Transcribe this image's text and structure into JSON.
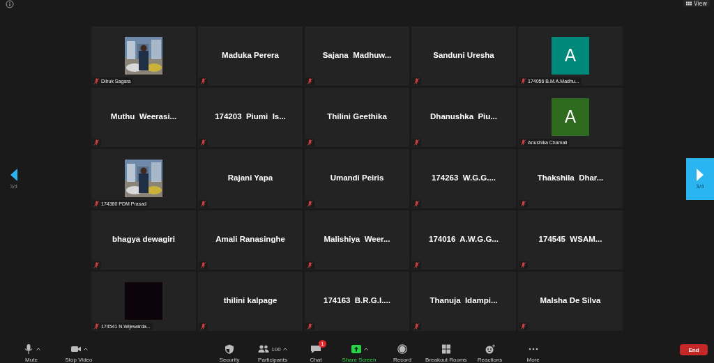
{
  "top_bar": {
    "view_button": "View"
  },
  "pager": {
    "left_page": "3/4",
    "right_page": "3/4",
    "right_highlighted": true
  },
  "tiles": [
    {
      "kind": "picture",
      "name": "Dilruk Sagara",
      "muted": true
    },
    {
      "kind": "name",
      "name": "Maduka Perera",
      "muted": true
    },
    {
      "kind": "name",
      "name": "Sajana  Madhuw...",
      "muted": true
    },
    {
      "kind": "name",
      "name": "Sanduni Uresha",
      "muted": true
    },
    {
      "kind": "avatar",
      "letter": "A",
      "color": "#00897b",
      "name": "174056 B.M.A.Madhu...",
      "muted": true
    },
    {
      "kind": "name",
      "name": "Muthu  Weerasi...",
      "muted": true
    },
    {
      "kind": "name",
      "name": "174203  Piumi  Is...",
      "muted": true
    },
    {
      "kind": "name",
      "name": "Thilini Geethika",
      "muted": true
    },
    {
      "kind": "name",
      "name": "Dhanushka  Piu...",
      "muted": true
    },
    {
      "kind": "avatar",
      "letter": "A",
      "color": "#2e6b1e",
      "name": "Anushika Chamali",
      "muted": true
    },
    {
      "kind": "picture",
      "name": "174380 PDM Prasad",
      "muted": true
    },
    {
      "kind": "name",
      "name": "Rajani Yapa",
      "muted": true
    },
    {
      "kind": "name",
      "name": "Umandi Peiris",
      "muted": true
    },
    {
      "kind": "name",
      "name": "174263  W.G.G....",
      "muted": true
    },
    {
      "kind": "name",
      "name": "Thakshila  Dhar...",
      "muted": true
    },
    {
      "kind": "name",
      "name": "bhagya dewagiri",
      "muted": true
    },
    {
      "kind": "name",
      "name": "Amali Ranasinghe",
      "muted": true
    },
    {
      "kind": "name",
      "name": "Malishiya  Weer...",
      "muted": true
    },
    {
      "kind": "name",
      "name": "174016  A.W.G.G...",
      "muted": true
    },
    {
      "kind": "name",
      "name": "174545  WSAM...",
      "muted": true
    },
    {
      "kind": "blank",
      "name": "174541 N.Wijewarda...",
      "muted": true
    },
    {
      "kind": "name",
      "name": "thilini kalpage",
      "muted": true
    },
    {
      "kind": "name",
      "name": "174163  B.R.G.I....",
      "muted": true
    },
    {
      "kind": "name",
      "name": "Thanuja  Idampi...",
      "muted": true
    },
    {
      "kind": "name",
      "name": "Malsha De Silva",
      "muted": true
    }
  ],
  "toolbar_left": [
    {
      "kind": "mic",
      "label": "Mute",
      "menu": true
    },
    {
      "kind": "video",
      "label": "Stop Video",
      "menu": true
    }
  ],
  "toolbar_center": [
    {
      "kind": "security",
      "label": "Security",
      "menu": false
    },
    {
      "kind": "participants",
      "label": "Participants",
      "count": "100",
      "menu": true
    },
    {
      "kind": "chat",
      "label": "Chat",
      "badge": "1",
      "menu": false
    },
    {
      "kind": "share",
      "label": "Share Screen",
      "menu": true,
      "highlighted": true
    },
    {
      "kind": "record",
      "label": "Record",
      "menu": false
    },
    {
      "kind": "breakout",
      "label": "Breakout Rooms",
      "menu": false
    },
    {
      "kind": "reactions",
      "label": "Reactions",
      "menu": false
    },
    {
      "kind": "more",
      "label": "More",
      "menu": false
    }
  ],
  "end_button": "End"
}
